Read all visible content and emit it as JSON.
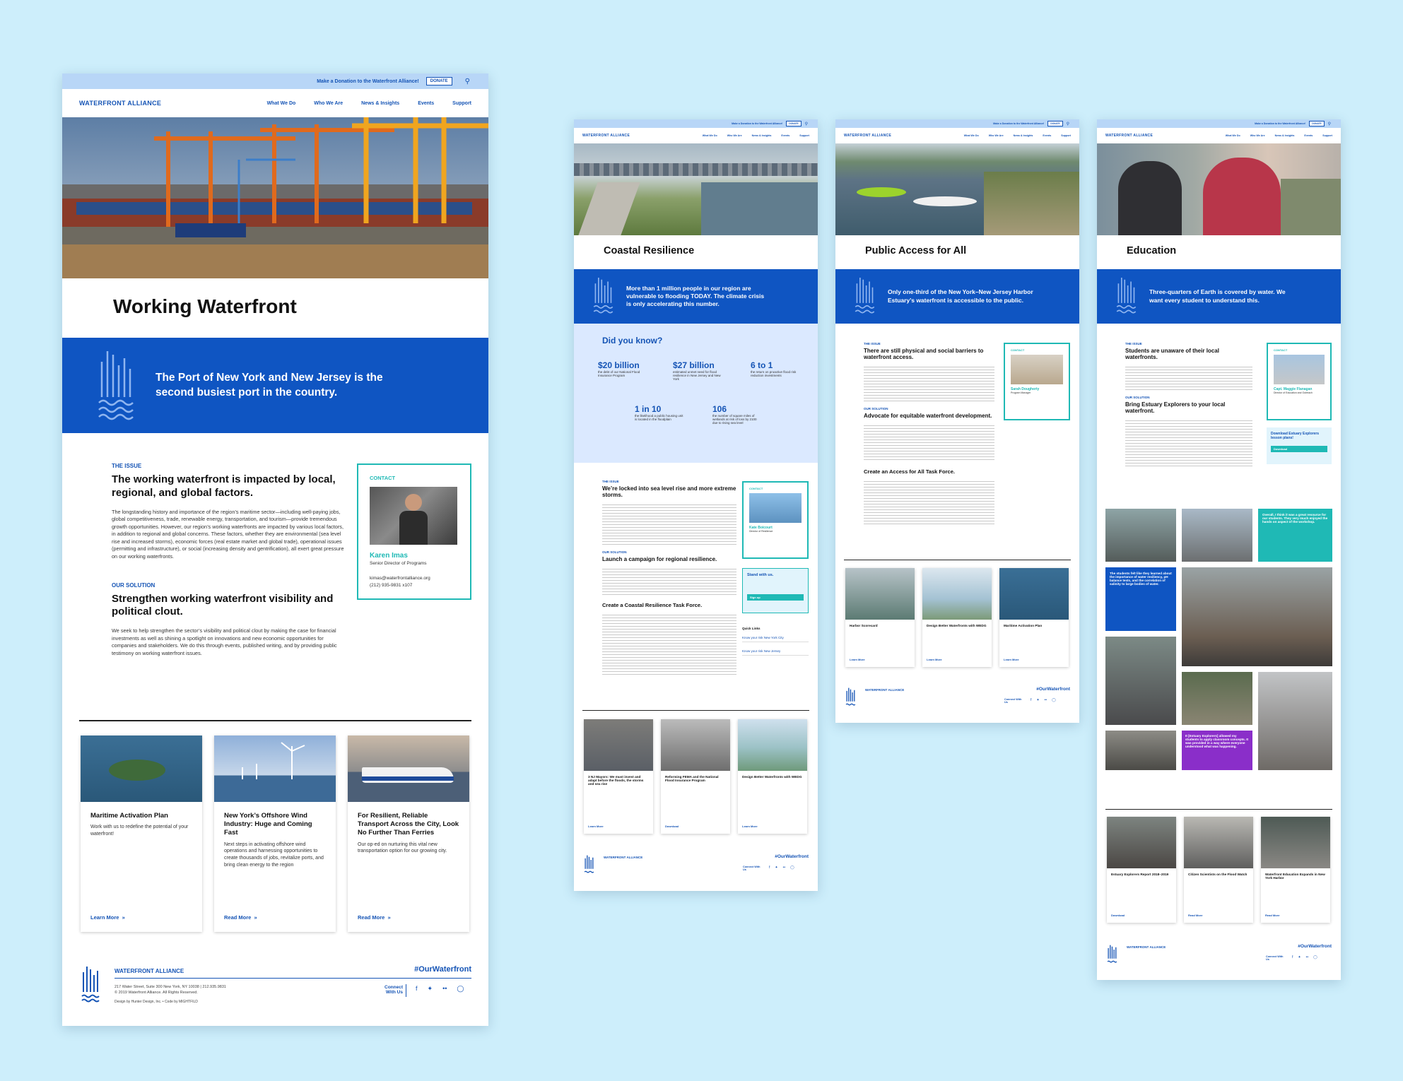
{
  "brand": {
    "name": "WATERFRONT ALLIANCE",
    "donate_text": "Make a Donation to the Waterfront Alliance!",
    "donate_label": "DONATE",
    "hashtag": "#OurWaterfront"
  },
  "nav": [
    "What We Do",
    "Who We Are",
    "News & Insights",
    "Events",
    "Support"
  ],
  "p1": {
    "title": "Working Waterfront",
    "quote": "The Port of New York and New Jersey is the second busiest port in the country.",
    "issue_label": "THE ISSUE",
    "issue_heading": "The working waterfront is impacted by local, regional, and global factors.",
    "issue_body": "The longstanding history and importance of the region’s maritime sector—including well-paying jobs, global competitiveness, trade, renewable energy, transportation, and tourism—provide tremendous growth opportunities. However, our region’s working waterfronts are impacted by various local factors, in addition to regional and global concerns. These factors, whether they are environmental (sea level rise and increased storms), economic forces (real estate market and global trade), operational issues (permitting and infrastructure), or social (increasing density and gentrification), all exert great pressure on our working waterfronts.",
    "solution_label": "OUR SOLUTION",
    "solution_heading": "Strengthen working waterfront visibility and political clout.",
    "solution_body": "We seek to help strengthen the sector’s visibility and political clout by making the case for financial investments as well as shining a spotlight on innovations and new economic opportunities for companies and stakeholders. We do this through events, published writing, and by providing public testimony on working waterfront issues.",
    "contact": {
      "label": "CONTACT",
      "name": "Karen Imas",
      "role": "Senior Director of Programs",
      "email": "kimas@waterfrontalliance.org",
      "phone": "(212) 935-9831 x107"
    },
    "cards": [
      {
        "title": "Maritime Activation Plan",
        "body": "Work with us to redefine the potential of your waterfront!",
        "link": "Learn More"
      },
      {
        "title": "New York’s Offshore Wind Industry: Huge and Coming Fast",
        "body": "Next steps in activating offshore wind operations and harnessing opportunities to create thousands of jobs, revitalize ports, and bring clean energy to the region",
        "link": "Read More"
      },
      {
        "title": "For Resilient, Reliable Transport Across the City, Look No Further Than Ferries",
        "body": "Our op-ed on nurturing this vital new transportation option for our growing city.",
        "link": "Read More"
      }
    ],
    "footer": {
      "address": "217 Water Street, Suite 300 New York, NY 10038 | 212.935.9831",
      "copyright": "© 2019 Waterfront Alliance. All Rights Reserved.",
      "credit": "Design by Hunter Design, Inc. • Code by MIGHTFILD",
      "connect": "Connect With Us"
    }
  },
  "p2": {
    "title": "Coastal Resilience",
    "quote": "More than 1 million people in our region are vulnerable to flooding TODAY. The climate crisis is only accelerating this number.",
    "dyk_title": "Did you know?",
    "stats": [
      {
        "v": "$20 billion",
        "d": "the debt of our National Flood Insurance Program"
      },
      {
        "v": "$27 billion",
        "d": "estimated unmet need for flood resilience in New Jersey and New York"
      },
      {
        "v": "6 to 1",
        "d": "the return on proactive flood risk reduction investments"
      },
      {
        "v": "1 in 10",
        "d": "the likelihood a public housing unit is located in the floodplain"
      },
      {
        "v": "106",
        "d": "the number of square miles of wetlands at risk of loss by 2100 due to rising sea level"
      }
    ],
    "issue_label": "THE ISSUE",
    "issue_heading": "We’re locked into sea level rise and more extreme storms.",
    "solution_label": "OUR SOLUTION",
    "solution_heading": "Launch a campaign for regional resilience.",
    "h3": "Create a Coastal Resilience Task Force.",
    "contact": {
      "label": "CONTACT",
      "name": "Kate Boicourt",
      "role": "Director of Resilience"
    },
    "standwith": "Stand with us.",
    "signup": "Sign up",
    "quick": "Quick Links",
    "ql": [
      "Know your risk New York City",
      "Know your risk New Jersey"
    ],
    "cards": [
      {
        "title": "3 NJ Mayors: We must invest and adapt before the floods, the storms and sea rise",
        "link": "Learn More"
      },
      {
        "title": "Reforming FEMA and the National Flood Insurance Program",
        "link": "Download"
      },
      {
        "title": "Design Better Waterfronts with WEDG",
        "link": "Learn More"
      }
    ],
    "connect": "Connect With Us"
  },
  "p3": {
    "title": "Public Access for All",
    "quote": "Only one-third of the New York–New Jersey Harbor Estuary’s waterfront is accessible to the public.",
    "issue_label": "THE ISSUE",
    "issue_heading": "There are still physical and social barriers to waterfront access.",
    "solution_label": "OUR SOLUTION",
    "solution_heading": "Advocate for equitable waterfront development.",
    "h3": "Create an Access for All Task Force.",
    "contact": {
      "label": "CONTACT",
      "name": "Sarah Dougherty",
      "role": "Program Manager"
    },
    "cards": [
      {
        "title": "Harbor Scorecard",
        "link": "Learn More"
      },
      {
        "title": "Design Better Waterfronts with WEDG",
        "link": "Learn More"
      },
      {
        "title": "Maritime Activation Plan",
        "link": "Learn More"
      }
    ],
    "connect": "Connect With Us"
  },
  "p4": {
    "title": "Education",
    "quote": "Three-quarters of Earth is covered by water. We want every student to understand this.",
    "issue_label": "THE ISSUE",
    "issue_heading": "Students are unaware of their local waterfronts.",
    "solution_label": "OUR SOLUTION",
    "solution_heading": "Bring Estuary Explorers to your local waterfront.",
    "contact": {
      "label": "CONTACT",
      "name": "Capt. Maggie Flanagan",
      "role": "Director of Education and Outreach"
    },
    "dl_title": "Download Estuary Explorers lesson plans!",
    "dl_btn": "Download",
    "q1": "Overall, I think it was a great resource for our students. They very much enjoyed the hands on aspect of the workshop.",
    "q2": "The students felt like they learned about the importance of water resiliency, pH balance tests, and the correlation of salinity to large bodies of water.",
    "q3": "It [Estuary Explorers] allowed my students to apply classroom concepts. It was provided in a way where everyone understood what was happening.",
    "cards": [
      {
        "title": "Estuary Explorers Report 2018–2019",
        "link": "Download"
      },
      {
        "title": "Citizen Scientists on the Flood Watch",
        "link": "Read More"
      },
      {
        "title": "Waterfront Education Expands in New York Harbor",
        "link": "Read More"
      }
    ],
    "connect": "Connect With Us"
  }
}
